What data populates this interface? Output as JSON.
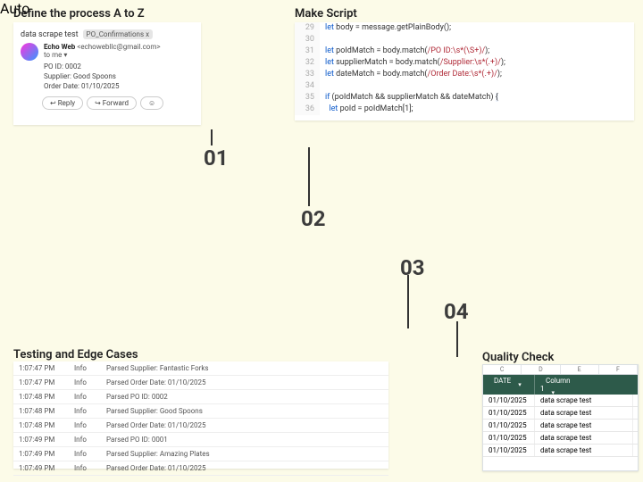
{
  "headings": {
    "p1": "Define the process A to Z",
    "p2": "Make Script",
    "p3": "Testing and Edge Cases",
    "p4": "Quality Check"
  },
  "steps": {
    "s1": "01",
    "s2": "02",
    "s3": "03",
    "s4": "04"
  },
  "email": {
    "subject": "data scrape test",
    "tag": "PO_Confirmations x",
    "sender_name": "Echo Web",
    "sender_addr": "<echowebllc@gmail.com>",
    "to_line": "to me ▾",
    "body_l1": "PO ID: 0002",
    "body_l2": "Supplier: Good Spoons",
    "body_l3": "Order Date: 01/10/2025",
    "reply": "↩ Reply",
    "forward": "↪ Forward",
    "react": "☺"
  },
  "code": {
    "lines": [
      {
        "n": "29",
        "html": "<span class='kw'>let</span> body = message.getPlainBody();"
      },
      {
        "n": "30",
        "html": ""
      },
      {
        "n": "31",
        "html": "<span class='kw'>let</span> poIdMatch = body.match(<span class='re'>/PO ID:\\s*(\\S+)/</span>);"
      },
      {
        "n": "32",
        "html": "<span class='kw'>let</span> supplierMatch = body.match(<span class='re'>/Supplier:\\s*(.+)/</span>);"
      },
      {
        "n": "33",
        "html": "<span class='kw'>let</span> dateMatch = body.match(<span class='re'>/Order Date:\\s*(.+)/</span>);"
      },
      {
        "n": "34",
        "html": ""
      },
      {
        "n": "35",
        "html": "<span class='kw'>if</span> (poIdMatch && supplierMatch && dateMatch) <span class='cur'>{</span>"
      },
      {
        "n": "36",
        "html": "  <span class='kw'>let</span> poId = poIdMatch[1];"
      }
    ]
  },
  "log": [
    {
      "t": "1:07:47 PM",
      "lvl": "Info",
      "msg": "Parsed Supplier: Fantastic Forks"
    },
    {
      "t": "1:07:47 PM",
      "lvl": "Info",
      "msg": "Parsed Order Date: 01/10/2025"
    },
    {
      "t": "1:07:48 PM",
      "lvl": "Info",
      "msg": "Parsed PO ID: 0002"
    },
    {
      "t": "1:07:48 PM",
      "lvl": "Info",
      "msg": "Parsed Supplier: Good Spoons"
    },
    {
      "t": "1:07:48 PM",
      "lvl": "Info",
      "msg": "Parsed Order Date: 01/10/2025"
    },
    {
      "t": "1:07:49 PM",
      "lvl": "Info",
      "msg": "Parsed PO ID: 0001"
    },
    {
      "t": "1:07:49 PM",
      "lvl": "Info",
      "msg": "Parsed Supplier: Amazing Plates"
    },
    {
      "t": "1:07:49 PM",
      "lvl": "Info",
      "msg": "Parsed Order Date: 01/10/2025"
    }
  ],
  "sheet": {
    "cols": [
      "C",
      "D",
      "E",
      "F"
    ],
    "h1": "DATE",
    "h2": "Column 1",
    "rows": [
      {
        "d": "01/10/2025",
        "v": "data scrape test"
      },
      {
        "d": "01/10/2025",
        "v": "data scrape test"
      },
      {
        "d": "01/10/2025",
        "v": "data scrape test"
      },
      {
        "d": "01/10/2025",
        "v": "data scrape test"
      },
      {
        "d": "01/10/2025",
        "v": "data scrape test"
      }
    ],
    "shape": "Auto"
  }
}
